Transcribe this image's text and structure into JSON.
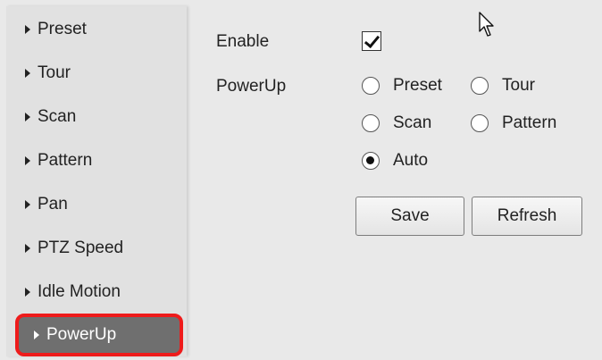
{
  "sidebar": {
    "items": [
      {
        "label": "Preset"
      },
      {
        "label": "Tour"
      },
      {
        "label": "Scan"
      },
      {
        "label": "Pattern"
      },
      {
        "label": "Pan"
      },
      {
        "label": "PTZ Speed"
      },
      {
        "label": "Idle Motion"
      },
      {
        "label": "PowerUp",
        "active": true
      }
    ]
  },
  "form": {
    "enable_label": "Enable",
    "enable_checked": true,
    "powerup_label": "PowerUp",
    "options": [
      {
        "label": "Preset",
        "checked": false
      },
      {
        "label": "Tour",
        "checked": false
      },
      {
        "label": "Scan",
        "checked": false
      },
      {
        "label": "Pattern",
        "checked": false
      },
      {
        "label": "Auto",
        "checked": true
      }
    ],
    "save_label": "Save",
    "refresh_label": "Refresh"
  },
  "colors": {
    "active_item_bg": "#6f6f6f",
    "highlight_border": "#ee1b1b"
  },
  "icons": {
    "nav_arrow": "caret-right-icon",
    "cursor": "mouse-pointer-icon"
  }
}
